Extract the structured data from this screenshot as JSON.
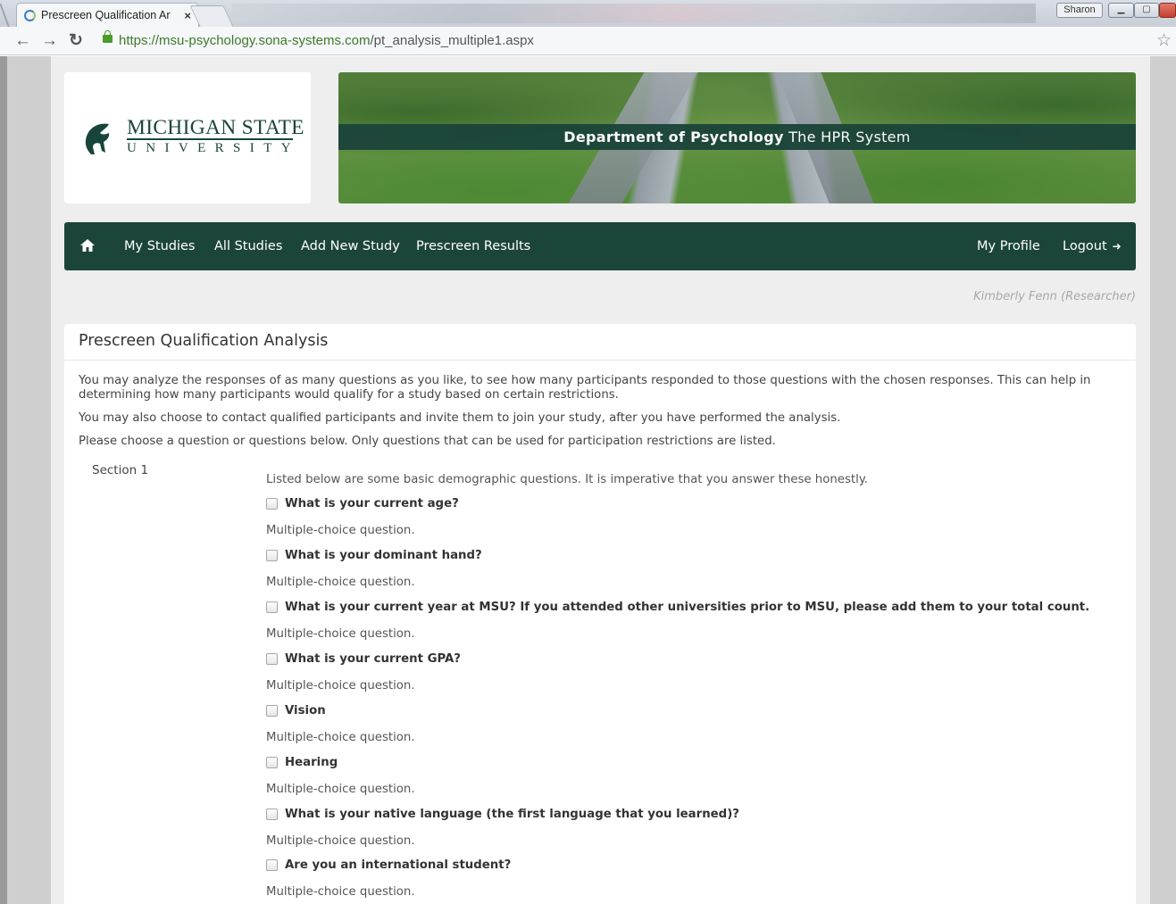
{
  "browser": {
    "tab_title": "Prescreen Qualification Ar",
    "tab_close": "×",
    "profile_name": "Sharon",
    "url_host": "https://msu-psychology.sona-systems.com",
    "url_path": "/pt_analysis_multiple1.aspx"
  },
  "header": {
    "university_name": "MICHIGAN STATE",
    "university_sub": "UNIVERSITY",
    "department": "Department of Psychology",
    "system_name": "The HPR System"
  },
  "nav": {
    "items": [
      "My Studies",
      "All Studies",
      "Add New Study",
      "Prescreen Results"
    ],
    "my_profile": "My Profile",
    "logout": "Logout"
  },
  "user": {
    "researcher_label": "Kimberly Fenn (Researcher)"
  },
  "panel": {
    "title": "Prescreen Qualification Analysis",
    "intro_1": "You may analyze the responses of as many questions as you like, to see how many participants responded to those questions with the chosen responses. This can help in determining how many participants would qualify for a study based on certain restrictions.",
    "intro_2": "You may also choose to contact qualified participants and invite them to join your study, after you have performed the analysis.",
    "intro_3": "Please choose a question or questions below. Only questions that can be used for participation restrictions are listed."
  },
  "section": {
    "label": "Section 1",
    "intro": "Listed below are some basic demographic questions. It is imperative that you answer these honestly.",
    "questions": [
      {
        "label": "What is your current age?",
        "type": "Multiple-choice question.",
        "checked": false
      },
      {
        "label": "What is your dominant hand?",
        "type": "Multiple-choice question.",
        "checked": false
      },
      {
        "label": "What is your current year at MSU? If you attended other universities prior to MSU, please add them to your total count.",
        "type": "Multiple-choice question.",
        "checked": false
      },
      {
        "label": "What is your current GPA?",
        "type": "Multiple-choice question.",
        "checked": false
      },
      {
        "label": "Vision",
        "type": "Multiple-choice question.",
        "checked": false
      },
      {
        "label": "Hearing",
        "type": "Multiple-choice question.",
        "checked": false
      },
      {
        "label": "What is your native language (the first language that you learned)?",
        "type": "Multiple-choice question.",
        "checked": false
      },
      {
        "label": "Are you an international student?",
        "type": "Multiple-choice question.",
        "checked": false
      }
    ]
  },
  "colors": {
    "brand_green": "#1c453a",
    "link_green": "#3d7a2a"
  }
}
